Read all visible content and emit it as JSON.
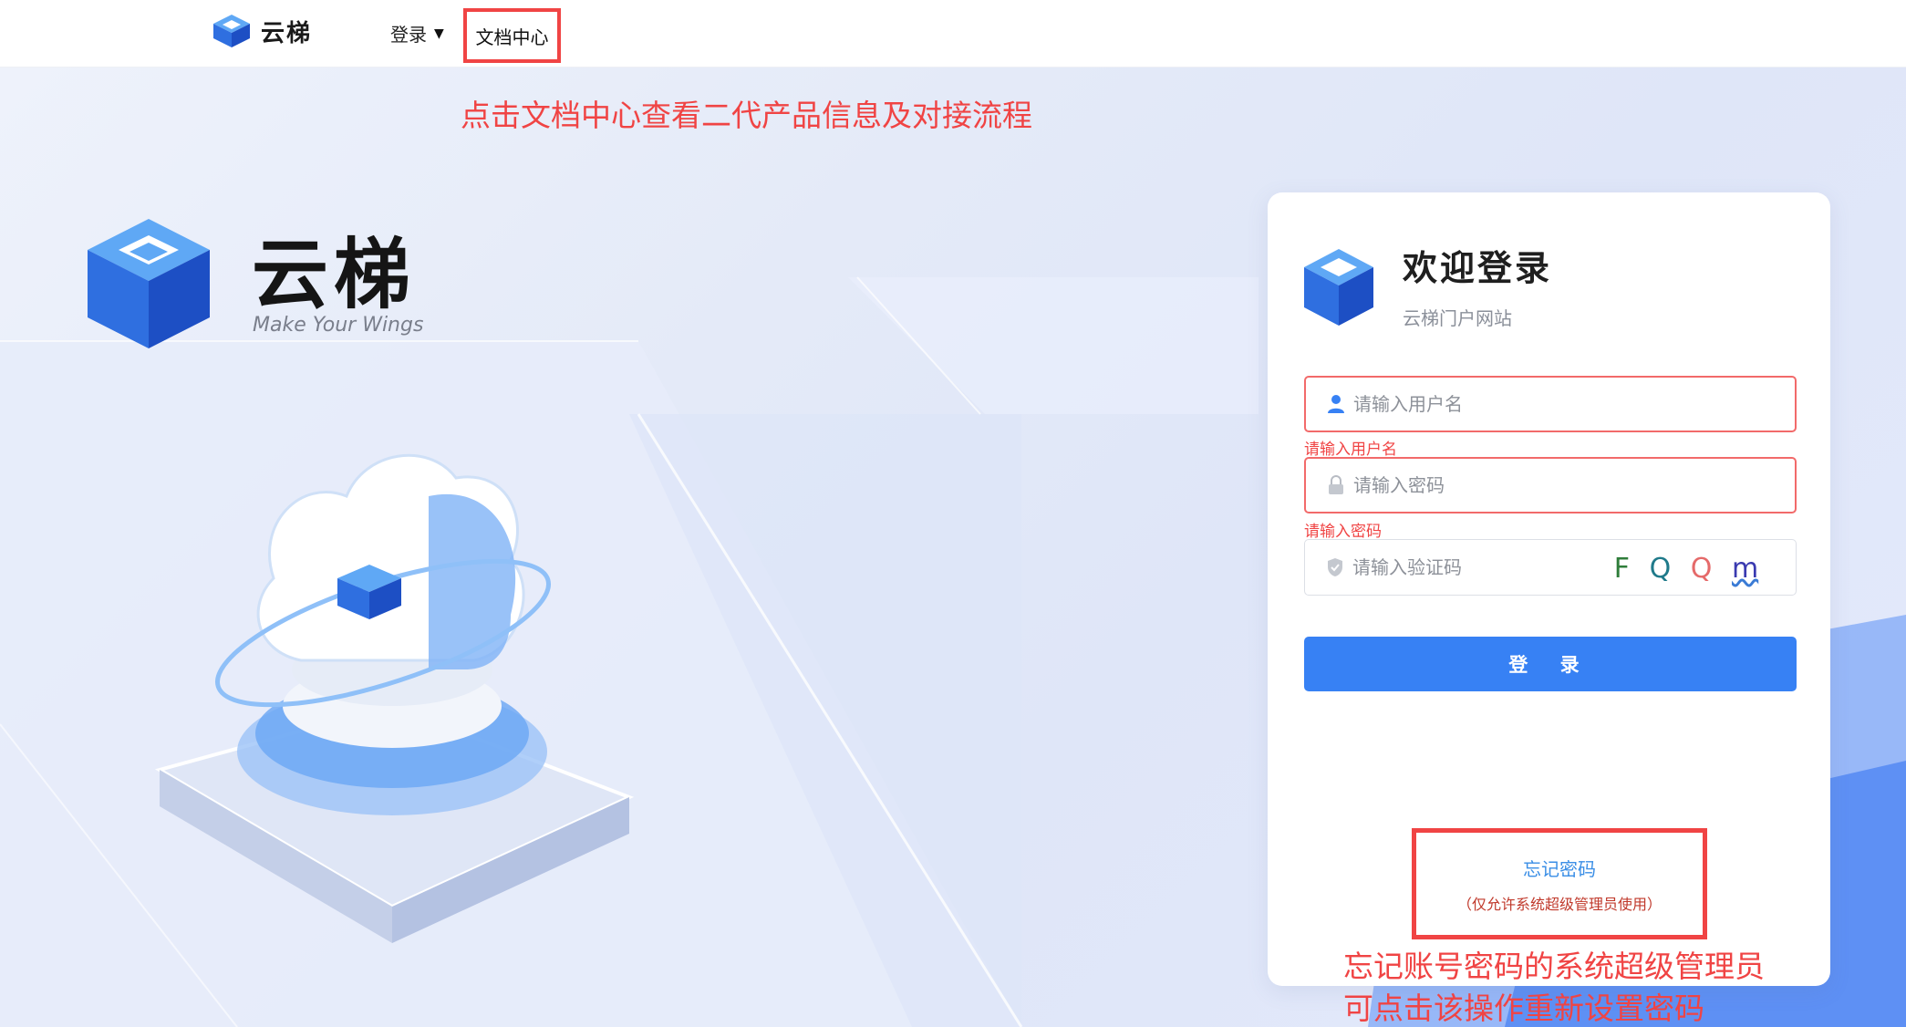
{
  "nav": {
    "brand": "云梯",
    "login_menu": "登录",
    "docs_link": "文档中心"
  },
  "hero": {
    "title": "云梯",
    "slogan": "Make Your Wings"
  },
  "annotations": {
    "top": "点击文档中心查看二代产品信息及对接流程",
    "bottom_line1": "忘记账号密码的系统超级管理员",
    "bottom_line2": "可点击该操作重新设置密码"
  },
  "login_card": {
    "title": "欢迎登录",
    "subtitle": "云梯门户网站",
    "username_placeholder": "请输入用户名",
    "username_error": "请输入用户名",
    "password_placeholder": "请输入密码",
    "password_error": "请输入密码",
    "captcha_placeholder": "请输入验证码",
    "captcha_chars": [
      "F",
      "Q",
      "Q",
      "m"
    ],
    "login_button": "登 录",
    "forgot_password": "忘记密码",
    "forgot_note": "（仅允许系统超级管理员使用）"
  },
  "colors": {
    "accent": "#3781f4",
    "error": "#f04444",
    "link": "#3a8ee6"
  },
  "icons": [
    "logo-icon",
    "caret-down-icon",
    "user-icon",
    "lock-icon",
    "shield-icon",
    "cloud-illustration"
  ]
}
